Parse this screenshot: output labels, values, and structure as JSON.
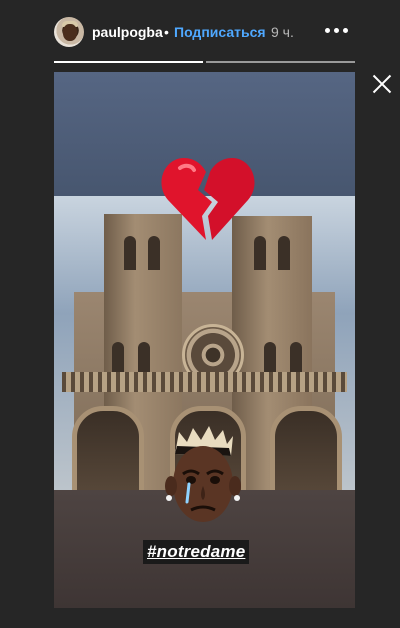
{
  "header": {
    "username": "paulpogba",
    "separator": "•",
    "follow_label": "Подписаться",
    "timestamp": "9 ч."
  },
  "icons": {
    "more": "more-options-icon",
    "close": "close-icon",
    "avatar": "avatar",
    "sticker_heart": "broken-heart-emoji",
    "sticker_face": "crying-face-sticker"
  },
  "progress": {
    "segments": [
      1.0,
      0.0
    ]
  },
  "story": {
    "hashtag": "#notredame"
  },
  "colors": {
    "background": "#262626",
    "follow_link": "#4fa8ff",
    "heart": "#e0142c"
  }
}
